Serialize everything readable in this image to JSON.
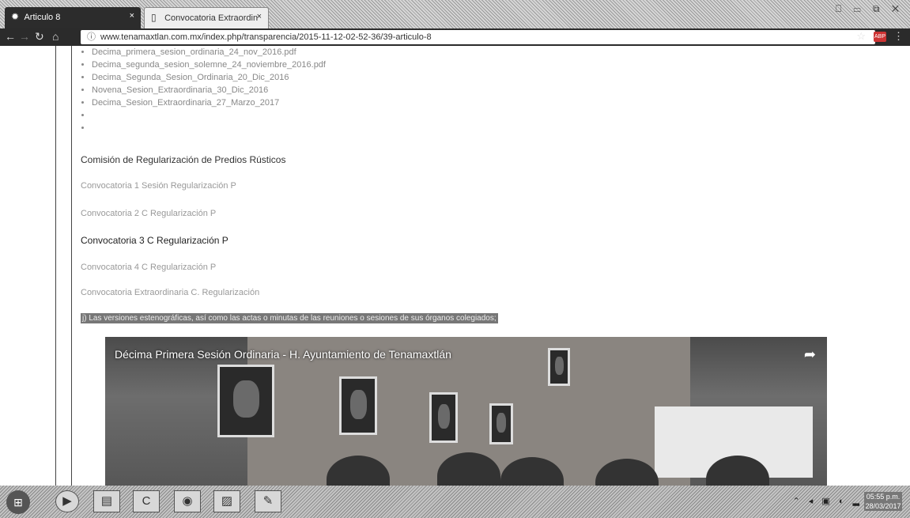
{
  "browser": {
    "tabs": [
      {
        "label": "Articulo 8",
        "icon": "tenamaxtlan-favicon",
        "active": true
      },
      {
        "label": "Convocatoria Extraordin",
        "icon": "document-icon",
        "active": false
      }
    ],
    "window_controls": "⎕ ▭ ⧉ ✕",
    "url": "www.tenamaxtlan.com.mx/index.php/transparencia/2015-11-12-02-52-36/39-articulo-8"
  },
  "page": {
    "document_list": [
      "Decima_primera_sesion_ordinaria_24_nov_2016.pdf",
      "Decima_segunda_sesion_solemne_24_noviembre_2016.pdf",
      "Decima_Segunda_Sesion_Ordinaria_20_Dic_2016",
      "Novena_Sesion_Extraordinaria_30_Dic_2016",
      "Decima_Sesion_Extraordinaria_27_Marzo_2017",
      "",
      ""
    ],
    "section_title": "Comisión de Regularización de Predios Rústicos",
    "convocatorias": [
      "Convocatoria 1 Sesión Regularización P",
      "Convocatoria 2 C Regularización P",
      "Convocatoria 3 C Regularización P",
      "Convocatoria 4 C Regularización P",
      "Convocatoria Extraordinaria C. Regularización"
    ],
    "highlight_text": "j) Las versiones estenográficas, así como las actas o minutas de las reuniones o sesiones de sus órganos colegiados;",
    "video": {
      "title": "Décima Primera Sesión Ordinaria - H. Ayuntamiento de Tenamaxtlán",
      "share_icon": "share-arrow-icon"
    }
  },
  "taskbar": {
    "buttons": [
      "start",
      "media-player",
      "file-explorer",
      "ccleaner",
      "chrome",
      "photo-viewer",
      "screenshot-tool"
    ],
    "tray_icons": "⌃ ◂ ▣ ◐ ▂",
    "clock_time": "05:55 p.m.",
    "clock_date": "28/03/2017"
  },
  "colors": {
    "browser_dark": "#2b2b2b",
    "link_gray": "#999999",
    "highlight_bg": "#777777"
  }
}
